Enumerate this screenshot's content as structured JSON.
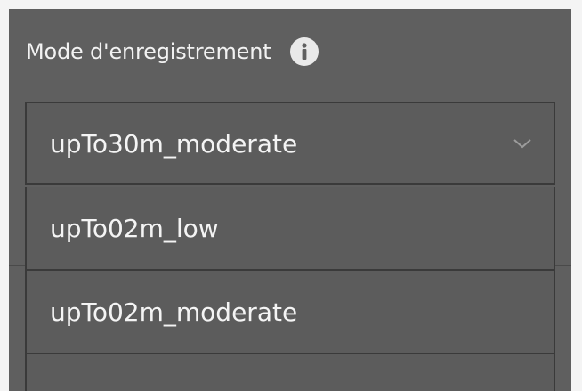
{
  "field": {
    "label": "Mode d'enregistrement",
    "info_icon": "info-icon"
  },
  "select": {
    "value": "upTo30m_moderate",
    "chevron_icon": "chevron-down-icon"
  },
  "options": [
    {
      "label": "upTo02m_low"
    },
    {
      "label": "upTo02m_moderate"
    }
  ]
}
